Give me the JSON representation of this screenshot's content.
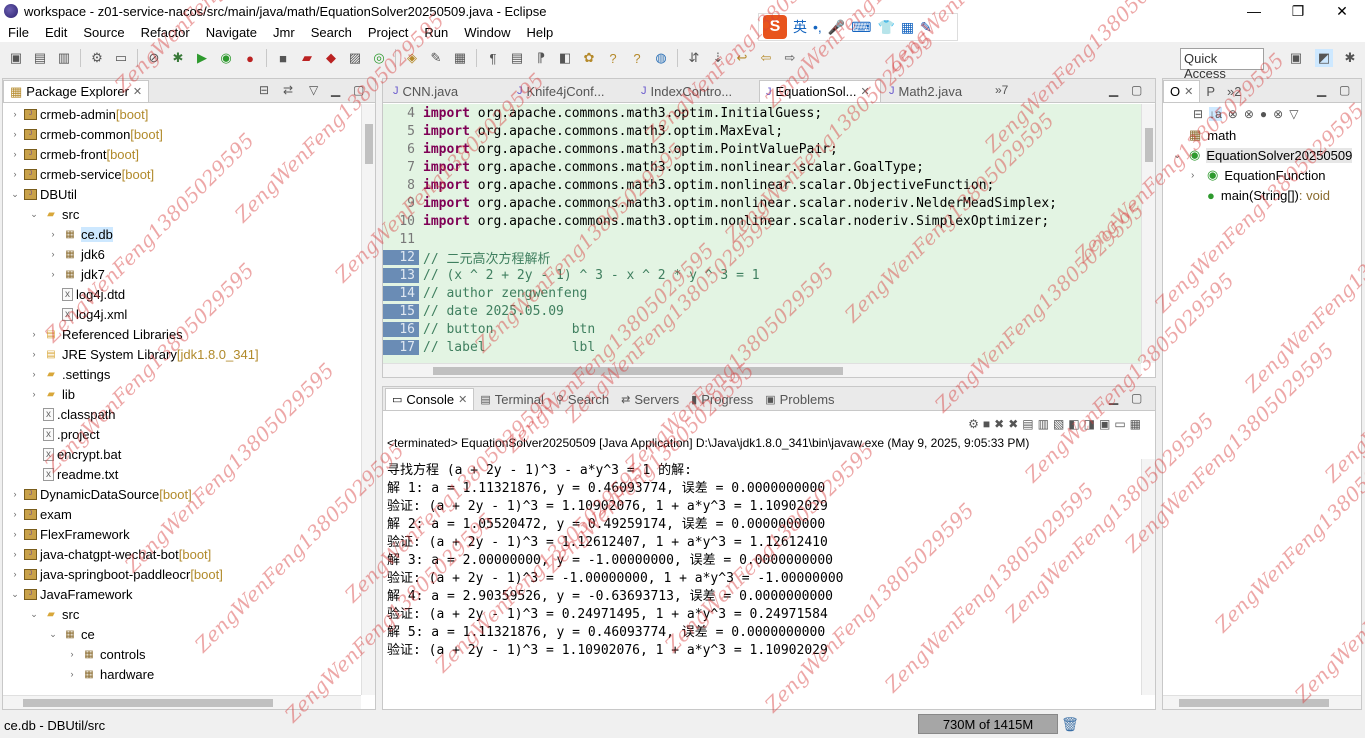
{
  "window": {
    "title": "workspace - z01-service-nacos/src/main/java/math/EquationSolver20250509.java - Eclipse",
    "controls": [
      "—",
      "❐",
      "✕"
    ]
  },
  "ime": {
    "logo": "S",
    "items": [
      "英",
      "•,",
      "🎤",
      "⌨",
      "👕",
      "▦",
      "✎"
    ]
  },
  "menu": [
    "File",
    "Edit",
    "Source",
    "Refactor",
    "Navigate",
    "Jmr",
    "Search",
    "Project",
    "Run",
    "Window",
    "Help"
  ],
  "toolbar": {
    "quick_access": "Quick Access"
  },
  "package_explorer": {
    "title": "Package Explorer",
    "items": [
      {
        "level": 0,
        "arrow": "›",
        "icon": "project",
        "label": "crmeb-admin",
        "suffix": " [boot]"
      },
      {
        "level": 0,
        "arrow": "›",
        "icon": "project",
        "label": "crmeb-common",
        "suffix": " [boot]"
      },
      {
        "level": 0,
        "arrow": "›",
        "icon": "project",
        "label": "crmeb-front",
        "suffix": " [boot]"
      },
      {
        "level": 0,
        "arrow": "›",
        "icon": "project",
        "label": "crmeb-service",
        "suffix": " [boot]"
      },
      {
        "level": 0,
        "arrow": "⌄",
        "icon": "project",
        "label": "DBUtil",
        "suffix": ""
      },
      {
        "level": 1,
        "arrow": "⌄",
        "icon": "folder",
        "label": "src",
        "suffix": ""
      },
      {
        "level": 2,
        "arrow": "›",
        "icon": "pkg",
        "label": "ce.db",
        "suffix": "",
        "selected": true
      },
      {
        "level": 2,
        "arrow": "›",
        "icon": "pkg",
        "label": "jdk6",
        "suffix": ""
      },
      {
        "level": 2,
        "arrow": "›",
        "icon": "pkg",
        "label": "jdk7",
        "suffix": ""
      },
      {
        "level": 2,
        "arrow": "",
        "icon": "file",
        "label": "log4j.dtd",
        "suffix": ""
      },
      {
        "level": 2,
        "arrow": "",
        "icon": "file",
        "label": "log4j.xml",
        "suffix": ""
      },
      {
        "level": 1,
        "arrow": "›",
        "icon": "lib",
        "label": "Referenced Libraries",
        "suffix": ""
      },
      {
        "level": 1,
        "arrow": "›",
        "icon": "lib",
        "label": "JRE System Library",
        "suffix": " [jdk1.8.0_341]"
      },
      {
        "level": 1,
        "arrow": "›",
        "icon": "folder",
        "label": ".settings",
        "suffix": ""
      },
      {
        "level": 1,
        "arrow": "›",
        "icon": "folder",
        "label": "lib",
        "suffix": ""
      },
      {
        "level": 1,
        "arrow": "",
        "icon": "file",
        "label": ".classpath",
        "suffix": ""
      },
      {
        "level": 1,
        "arrow": "",
        "icon": "file",
        "label": ".project",
        "suffix": ""
      },
      {
        "level": 1,
        "arrow": "",
        "icon": "file",
        "label": "encrypt.bat",
        "suffix": ""
      },
      {
        "level": 1,
        "arrow": "",
        "icon": "file",
        "label": "readme.txt",
        "suffix": ""
      },
      {
        "level": 0,
        "arrow": "›",
        "icon": "project",
        "label": "DynamicDataSource",
        "suffix": " [boot]"
      },
      {
        "level": 0,
        "arrow": "›",
        "icon": "project",
        "label": "exam",
        "suffix": ""
      },
      {
        "level": 0,
        "arrow": "›",
        "icon": "project",
        "label": "FlexFramework",
        "suffix": ""
      },
      {
        "level": 0,
        "arrow": "›",
        "icon": "project",
        "label": "java-chatgpt-wechat-bot",
        "suffix": " [boot]"
      },
      {
        "level": 0,
        "arrow": "›",
        "icon": "project",
        "label": "java-springboot-paddleocr",
        "suffix": " [boot]"
      },
      {
        "level": 0,
        "arrow": "⌄",
        "icon": "project",
        "label": "JavaFramework",
        "suffix": ""
      },
      {
        "level": 1,
        "arrow": "⌄",
        "icon": "folder",
        "label": "src",
        "suffix": ""
      },
      {
        "level": 2,
        "arrow": "⌄",
        "icon": "pkg",
        "label": "ce",
        "suffix": ""
      },
      {
        "level": 3,
        "arrow": "›",
        "icon": "pkg",
        "label": "controls",
        "suffix": ""
      },
      {
        "level": 3,
        "arrow": "›",
        "icon": "pkg",
        "label": "hardware",
        "suffix": ""
      }
    ]
  },
  "editor": {
    "tabs": [
      {
        "label": "CNN.java",
        "active": false
      },
      {
        "label": "Knife4jConf...",
        "active": false
      },
      {
        "label": "IndexContro...",
        "active": false
      },
      {
        "label": "EquationSol...",
        "active": true
      },
      {
        "label": "Math2.java",
        "active": false
      }
    ],
    "overflow": "»7",
    "lines": [
      {
        "n": "4",
        "kw": "import",
        "text": " org.apache.commons.math3.optim.InitialGuess;",
        "comment": false
      },
      {
        "n": "5",
        "kw": "import",
        "text": " org.apache.commons.math3.optim.MaxEval;",
        "comment": false
      },
      {
        "n": "6",
        "kw": "import",
        "text": " org.apache.commons.math3.optim.PointValuePair;",
        "comment": false
      },
      {
        "n": "7",
        "kw": "import",
        "text": " org.apache.commons.math3.optim.nonlinear.scalar.GoalType;",
        "comment": false
      },
      {
        "n": "8",
        "kw": "import",
        "text": " org.apache.commons.math3.optim.nonlinear.scalar.ObjectiveFunction;",
        "comment": false
      },
      {
        "n": "9",
        "kw": "import",
        "text": " org.apache.commons.math3.optim.nonlinear.scalar.noderiv.NelderMeadSimplex;",
        "comment": false
      },
      {
        "n": "10",
        "kw": "import",
        "text": " org.apache.commons.math3.optim.nonlinear.scalar.noderiv.SimplexOptimizer;",
        "comment": false
      },
      {
        "n": "11",
        "kw": "",
        "text": "",
        "comment": false
      },
      {
        "n": "12",
        "kw": "",
        "text": "// 二元高次方程解析",
        "comment": true
      },
      {
        "n": "13",
        "kw": "",
        "text": "// (x ^ 2 + 2y - 1) ^ 3 - x ^ 2 * y ^ 3 = 1",
        "comment": true
      },
      {
        "n": "14",
        "kw": "",
        "text": "// author zengwenfeng",
        "comment": true
      },
      {
        "n": "15",
        "kw": "",
        "text": "// date 2025.05.09",
        "comment": true
      },
      {
        "n": "16",
        "kw": "",
        "text": "// button          btn",
        "comment": true
      },
      {
        "n": "17",
        "kw": "",
        "text": "// label           lbl",
        "comment": true
      }
    ]
  },
  "console_panel": {
    "tabs": [
      {
        "label": "Console",
        "active": true
      },
      {
        "label": "Terminal",
        "active": false
      },
      {
        "label": "Search",
        "active": false
      },
      {
        "label": "Servers",
        "active": false
      },
      {
        "label": "Progress",
        "active": false
      },
      {
        "label": "Problems",
        "active": false
      }
    ],
    "terminated": "<terminated> EquationSolver20250509 [Java Application] D:\\Java\\jdk1.8.0_341\\bin\\javaw.exe (May 9, 2025, 9:05:33 PM)",
    "lines": [
      "寻找方程 (a + 2y - 1)^3 - a*y^3 = 1 的解:",
      "解 1: a = 1.11321876, y = 0.46093774, 误差 = 0.0000000000",
      "验证: (a + 2y - 1)^3 = 1.10902076, 1 + a*y^3 = 1.10902029",
      "解 2: a = 1.05520472, y = 0.49259174, 误差 = 0.0000000000",
      "验证: (a + 2y - 1)^3 = 1.12612407, 1 + a*y^3 = 1.12612410",
      "解 3: a = 2.00000000, y = -1.00000000, 误差 = 0.0000000000",
      "验证: (a + 2y - 1)^3 = -1.00000000, 1 + a*y^3 = -1.00000000",
      "解 4: a = 2.90359526, y = -0.63693713, 误差 = 0.0000000000",
      "验证: (a + 2y - 1)^3 = 0.24971495, 1 + a*y^3 = 0.24971584",
      "解 5: a = 1.11321876, y = 0.46093774, 误差 = 0.0000000000",
      "验证: (a + 2y - 1)^3 = 1.10902076, 1 + a*y^3 = 1.10902029"
    ]
  },
  "outline": {
    "tabs": [
      "O",
      "P",
      "»2"
    ],
    "items": [
      {
        "level": 0,
        "arrow": "",
        "icon": "pkg",
        "label": "math",
        "suffix": ""
      },
      {
        "level": 0,
        "arrow": "⌄",
        "icon": "class",
        "label": "EquationSolver20250509",
        "suffix": ""
      },
      {
        "level": 1,
        "arrow": "›",
        "icon": "class",
        "label": "EquationFunction",
        "suffix": ""
      },
      {
        "level": 1,
        "arrow": "",
        "icon": "method",
        "label": "main(String[])",
        "suffix": " : void"
      }
    ]
  },
  "status": {
    "text": "ce.db - DBUtil/src",
    "heap": "730M of 1415M"
  },
  "watermark": "ZengWenFeng13805029595",
  "colors": {
    "editor_bg": "#e3f4e3",
    "keyword": "#7f0055",
    "comment": "#3f7f5f",
    "boot_suffix": "#b18a2b",
    "watermark": "#d73c3c"
  }
}
